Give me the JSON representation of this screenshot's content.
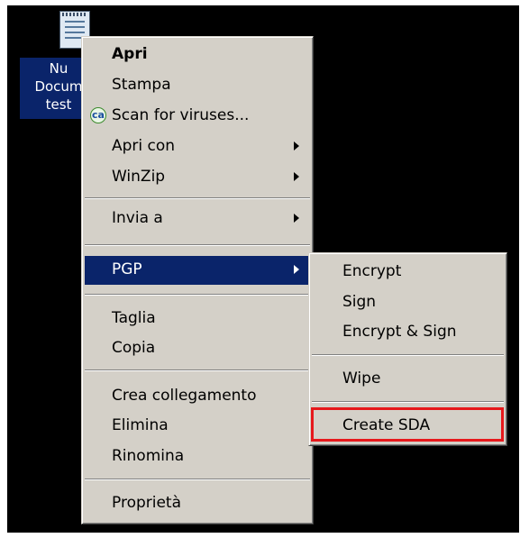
{
  "desktop_icon": {
    "label_lines": [
      "Nu",
      "Docum",
      "test"
    ]
  },
  "context_menu": {
    "items": [
      {
        "label": "Apri",
        "default": true
      },
      {
        "label": "Stampa"
      },
      {
        "label": "Scan for viruses...",
        "icon": "ca-antivirus-icon"
      },
      {
        "label": "Apri con",
        "submenu": true
      },
      {
        "label": "WinZip",
        "submenu": true
      },
      {
        "label": "Invia a",
        "submenu": true
      },
      {
        "label": "PGP",
        "submenu": true,
        "highlighted": true
      },
      {
        "label": "Taglia"
      },
      {
        "label": "Copia"
      },
      {
        "label": "Crea collegamento"
      },
      {
        "label": "Elimina"
      },
      {
        "label": "Rinomina"
      },
      {
        "label": "Proprietà"
      }
    ]
  },
  "pgp_submenu": {
    "items": [
      {
        "label": "Encrypt"
      },
      {
        "label": "Sign"
      },
      {
        "label": "Encrypt & Sign"
      },
      {
        "label": "Wipe"
      },
      {
        "label": "Create SDA",
        "outlined": true
      }
    ]
  },
  "icons": {
    "antivirus_badge_text": "ca"
  },
  "colors": {
    "highlight": "#0a246a",
    "menu_bg": "#d4d0c8",
    "annotation": "#e6191c"
  }
}
